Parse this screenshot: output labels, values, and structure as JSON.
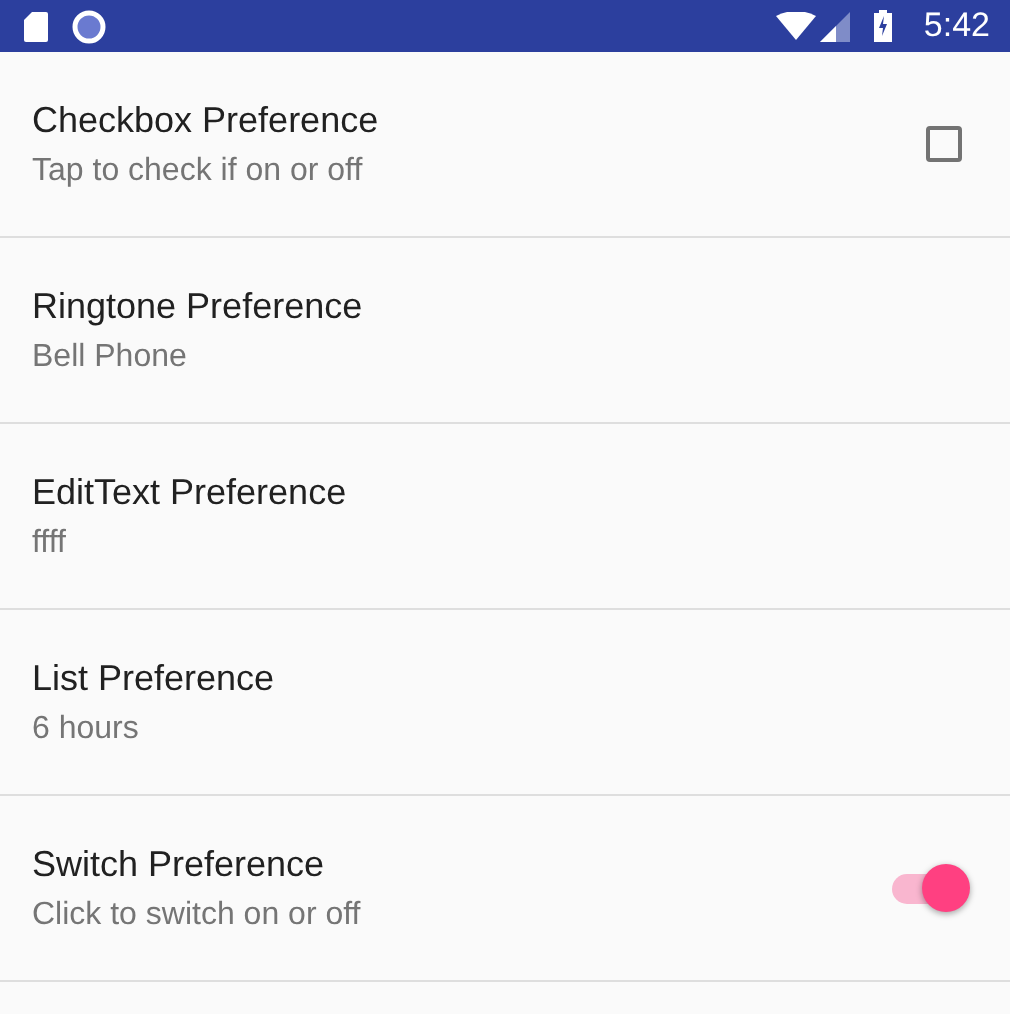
{
  "status_bar": {
    "time": "5:42"
  },
  "preferences": [
    {
      "kind": "checkbox",
      "title": "Checkbox Preference",
      "summary": "Tap to check if on or off",
      "checked": false
    },
    {
      "kind": "plain",
      "title": "Ringtone Preference",
      "summary": "Bell Phone"
    },
    {
      "kind": "plain",
      "title": "EditText Preference",
      "summary": "ffff"
    },
    {
      "kind": "plain",
      "title": "List Preference",
      "summary": "6 hours"
    },
    {
      "kind": "switch",
      "title": "Switch Preference",
      "summary": "Click to switch on or off",
      "on": true
    }
  ]
}
